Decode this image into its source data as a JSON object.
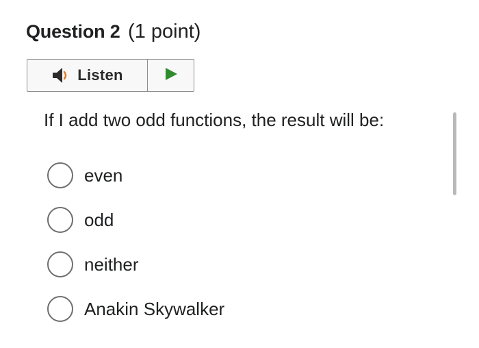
{
  "question": {
    "label": "Question 2",
    "points": "(1 point)",
    "prompt": "If I add two odd functions, the result will be:"
  },
  "listen": {
    "label": "Listen",
    "speaker_icon": "speaker-icon",
    "play_icon": "play-icon",
    "colors": {
      "speaker": "#2b2b2b",
      "waves": "#e07b22",
      "play": "#2e8b2e"
    }
  },
  "options": [
    {
      "label": "even",
      "selected": false
    },
    {
      "label": "odd",
      "selected": false
    },
    {
      "label": "neither",
      "selected": false
    },
    {
      "label": "Anakin Skywalker",
      "selected": false
    }
  ]
}
